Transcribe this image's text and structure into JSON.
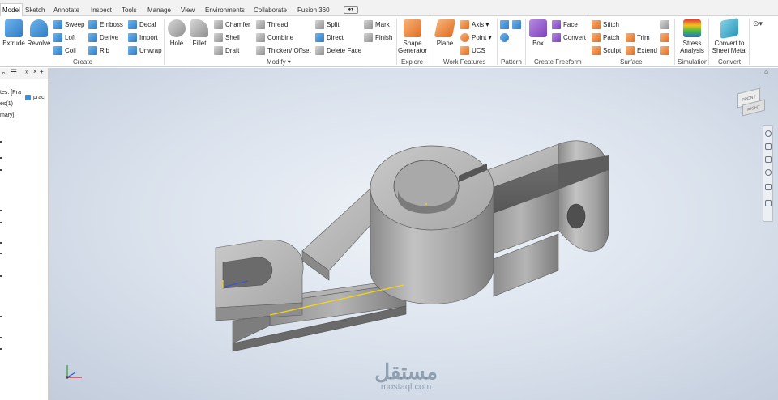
{
  "tabs": [
    "Model",
    "Sketch",
    "Annotate",
    "Inspect",
    "Tools",
    "Manage",
    "View",
    "Environments",
    "Collaborate",
    "Fusion 360"
  ],
  "ribbon": {
    "create": {
      "extrude": "Extrude",
      "revolve": "Revolve",
      "sweep": "Sweep",
      "loft": "Loft",
      "coil": "Coil",
      "emboss": "Emboss",
      "derive": "Derive",
      "rib": "Rib",
      "decal": "Decal",
      "import": "Import",
      "unwrap": "Unwrap",
      "label": "Create"
    },
    "modify": {
      "hole": "Hole",
      "fillet": "Fillet",
      "chamfer": "Chamfer",
      "shell": "Shell",
      "draft": "Draft",
      "thread": "Thread",
      "combine": "Combine",
      "thicken": "Thicken/ Offset",
      "split": "Split",
      "direct": "Direct",
      "delete_face": "Delete Face",
      "mark": "Mark",
      "finish": "Finish",
      "label": "Modify"
    },
    "explore": {
      "shape_generator_1": "Shape",
      "shape_generator_2": "Generator",
      "label": "Explore"
    },
    "work_features": {
      "plane": "Plane",
      "axis": "Axis",
      "point": "Point",
      "ucs": "UCS",
      "label": "Work Features"
    },
    "pattern": {
      "label": "Pattern"
    },
    "freeform": {
      "box": "Box",
      "face": "Face",
      "convert": "Convert",
      "label": "Create Freeform"
    },
    "surface": {
      "stitch": "Stitch",
      "patch": "Patch",
      "sculpt": "Sculpt",
      "trim": "Trim",
      "extend": "Extend",
      "label": "Surface"
    },
    "simulation": {
      "stress_1": "Stress",
      "stress_2": "Analysis",
      "label": "Simulation"
    },
    "convert": {
      "sheet_1": "Convert to",
      "sheet_2": "Sheet Metal",
      "label": "Convert"
    }
  },
  "browser": {
    "tab_item": "prac",
    "lines": [
      "tes: [Pra",
      "es(1)",
      "mary]"
    ]
  },
  "viewcube": {
    "front": "FRONT",
    "right": "RIGHT"
  },
  "watermark": {
    "arabic": "مستقل",
    "latin": "mostaql.com"
  },
  "colors": {
    "accent": "#2f7cc6",
    "edge_highlight": "#f2d21a",
    "model_gray": "#9a9a9a"
  }
}
